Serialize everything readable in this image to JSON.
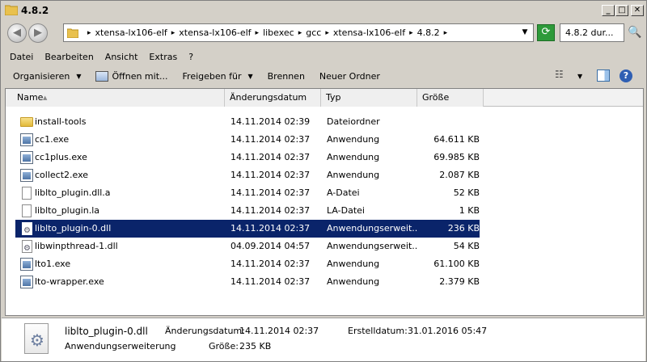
{
  "window": {
    "title": "4.8.2",
    "minimize": "_",
    "maximize": "□",
    "close": "✕"
  },
  "nav": {
    "back_glyph": "◀",
    "forward_glyph": "▶",
    "refresh_glyph": "⟳",
    "search_glyph": "🔍"
  },
  "address": {
    "crumbs": [
      "xtensa-lx106-elf",
      "xtensa-lx106-elf",
      "libexec",
      "gcc",
      "xtensa-lx106-elf",
      "4.8.2"
    ],
    "search_placeholder": "4.8.2 dur..."
  },
  "menu": [
    "Datei",
    "Bearbeiten",
    "Ansicht",
    "Extras",
    "?"
  ],
  "commands": {
    "organize": "Organisieren",
    "open_with": "Öffnen mit...",
    "share": "Freigeben für",
    "burn": "Brennen",
    "new_folder": "Neuer Ordner"
  },
  "columns": {
    "name": "Name",
    "date": "Änderungsdatum",
    "type": "Typ",
    "size": "Größe"
  },
  "files": [
    {
      "name": "install-tools",
      "date": "14.11.2014 02:39",
      "type": "Dateiordner",
      "size": "",
      "icon": "folder-icon"
    },
    {
      "name": "cc1.exe",
      "date": "14.11.2014 02:37",
      "type": "Anwendung",
      "size": "64.611 KB",
      "icon": "exe-icon"
    },
    {
      "name": "cc1plus.exe",
      "date": "14.11.2014 02:37",
      "type": "Anwendung",
      "size": "69.985 KB",
      "icon": "exe-icon"
    },
    {
      "name": "collect2.exe",
      "date": "14.11.2014 02:37",
      "type": "Anwendung",
      "size": "2.087 KB",
      "icon": "exe-icon"
    },
    {
      "name": "liblto_plugin.dll.a",
      "date": "14.11.2014 02:37",
      "type": "A-Datei",
      "size": "52 KB",
      "icon": "file-icon"
    },
    {
      "name": "liblto_plugin.la",
      "date": "14.11.2014 02:37",
      "type": "LA-Datei",
      "size": "1 KB",
      "icon": "file-icon"
    },
    {
      "name": "liblto_plugin-0.dll",
      "date": "14.11.2014 02:37",
      "type": "Anwendungserweit...",
      "size": "236 KB",
      "icon": "dll-icon",
      "selected": true
    },
    {
      "name": "libwinpthread-1.dll",
      "date": "04.09.2014 04:57",
      "type": "Anwendungserweit...",
      "size": "54 KB",
      "icon": "dll-icon"
    },
    {
      "name": "lto1.exe",
      "date": "14.11.2014 02:37",
      "type": "Anwendung",
      "size": "61.100 KB",
      "icon": "exe-icon"
    },
    {
      "name": "lto-wrapper.exe",
      "date": "14.11.2014 02:37",
      "type": "Anwendung",
      "size": "2.379 KB",
      "icon": "exe-icon"
    }
  ],
  "details": {
    "name": "liblto_plugin-0.dll",
    "type": "Anwendungserweiterung",
    "modified_label": "Änderungsdatum:",
    "modified_value": "14.11.2014 02:37",
    "size_label": "Größe:",
    "size_value": "235 KB",
    "created_label": "Erstelldatum:",
    "created_value": "31.01.2016 05:47"
  },
  "colors": {
    "selection": "#0a246a",
    "window_bg": "#d4d0c8"
  }
}
